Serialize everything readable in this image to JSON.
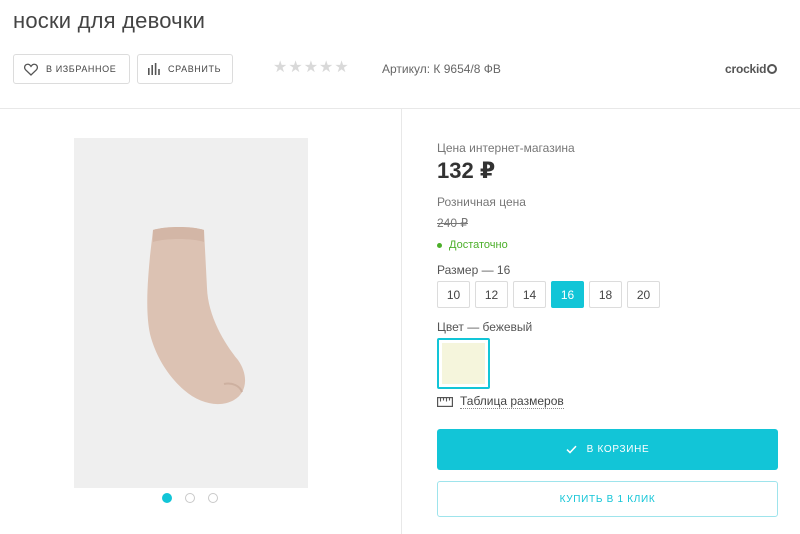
{
  "product": {
    "title": "носки для девочки",
    "article": "Артикул: К 9654/8 ФВ",
    "brand": "crockid",
    "rating": 0,
    "rating_max": 5
  },
  "actions": {
    "favorite_label": "В ИЗБРАННОЕ",
    "compare_label": "СРАВНИТЬ",
    "cart_label": "В КОРЗИНЕ",
    "one_click_label": "КУПИТЬ В 1 КЛИК"
  },
  "pricing": {
    "online_label": "Цена интернет-магазина",
    "online_price": "132 ₽",
    "retail_label": "Розничная цена",
    "retail_price": "240 ₽",
    "stock_status": "Достаточно"
  },
  "size": {
    "label": "Размер  —  16",
    "options": [
      "10",
      "12",
      "14",
      "16",
      "18",
      "20"
    ],
    "selected": "16"
  },
  "color": {
    "label": "Цвет  —  бежевый",
    "swatch": "#f5f5dc"
  },
  "size_table_link": "Таблица размеров",
  "gallery": {
    "slides": 3,
    "active": 0
  },
  "colors": {
    "accent": "#12c5d7",
    "stock_green": "#4caf2a",
    "sock": "#dcc2b3"
  },
  "icons": [
    "heart-icon",
    "bars-chart-icon",
    "star-icon",
    "ruler-icon",
    "check-icon"
  ]
}
